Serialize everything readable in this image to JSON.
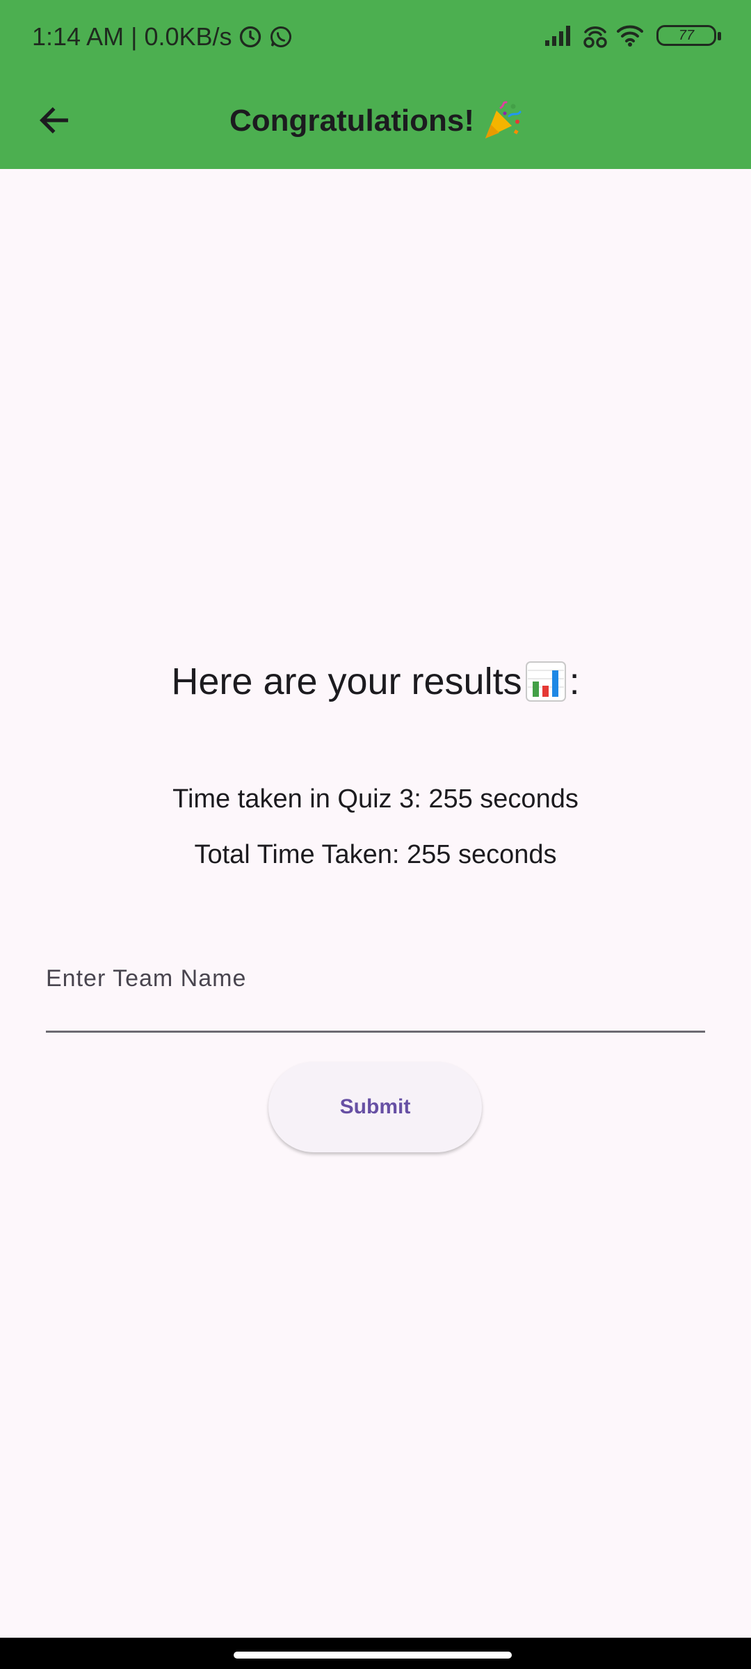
{
  "status_bar": {
    "time_and_speed": "1:14 AM | 0.0KB/s",
    "battery_level": "77",
    "icons": [
      "alarm-icon",
      "whatsapp-icon",
      "signal-icon",
      "hotspot-icon",
      "wifi-icon",
      "battery-icon"
    ]
  },
  "app_bar": {
    "title": "Congratulations!",
    "title_emoji": "party-popper-icon",
    "back_icon": "arrow-left-icon",
    "background": "#4caf50"
  },
  "results": {
    "heading": "Here are your results",
    "heading_suffix": ":",
    "heading_emoji": "bar-chart-icon",
    "quiz_time": "Time taken in Quiz 3: 255 seconds",
    "total_time": "Total Time Taken: 255 seconds"
  },
  "form": {
    "team_name_label": "Enter Team Name",
    "team_name_value": "",
    "submit_label": "Submit",
    "accent": "#6750a4"
  }
}
